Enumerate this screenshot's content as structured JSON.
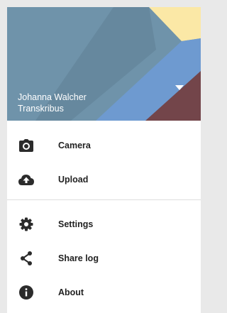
{
  "header": {
    "account_name": "Johanna Walcher",
    "account_subtitle": "Transkribus",
    "colors": {
      "base": "#6f93aa",
      "shape_dark": "#5f7f93",
      "shape_blue": "#6e9ad0",
      "shape_yellow": "#fbe8a6",
      "shape_brown": "#73454a"
    }
  },
  "menu": {
    "primary": [
      {
        "label": "Camera",
        "icon": "camera-icon"
      },
      {
        "label": "Upload",
        "icon": "cloud-upload-icon"
      }
    ],
    "secondary": [
      {
        "label": "Settings",
        "icon": "gear-icon"
      },
      {
        "label": "Share log",
        "icon": "share-icon"
      },
      {
        "label": "About",
        "icon": "info-icon"
      }
    ]
  }
}
